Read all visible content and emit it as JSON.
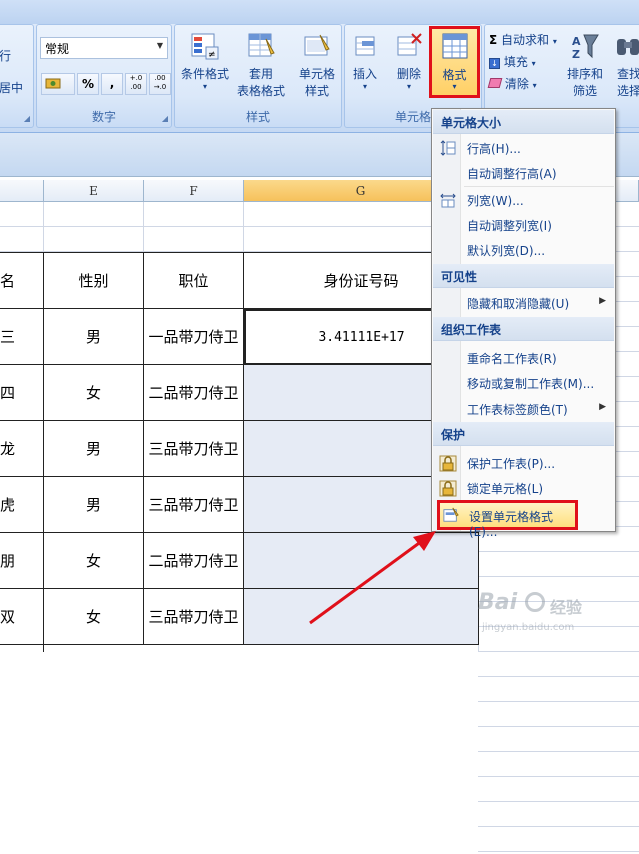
{
  "ribbon": {
    "align_group": {
      "label_frag1": "行",
      "label_frag2": "居中"
    },
    "number_group": {
      "label": "数字",
      "format_value": "常规",
      "percent": "%",
      "comma": ",",
      "inc_decimal": "+.0 .00",
      "dec_decimal": ".00 →.0"
    },
    "styles_group": {
      "label": "样式",
      "conditional_format": "条件格式",
      "table_format_l1": "套用",
      "table_format_l2": "表格格式",
      "cell_style_l1": "单元格",
      "cell_style_l2": "样式"
    },
    "cells_group": {
      "label": "单元格",
      "insert": "插入",
      "delete": "删除",
      "format": "格式"
    },
    "editing_group": {
      "autosum": "自动求和",
      "fill": "填充",
      "clear": "清除",
      "sort_l1": "排序和",
      "sort_l2": "筛选",
      "find_l1": "查找",
      "find_l2": "选择"
    }
  },
  "columns": [
    "E",
    "F",
    "G"
  ],
  "table": {
    "headers": [
      "名",
      "性别",
      "职位",
      "身份证号码"
    ],
    "rows": [
      [
        "三",
        "男",
        "一品带刀侍卫",
        "3.41111E+17"
      ],
      [
        "四",
        "女",
        "二品带刀侍卫",
        ""
      ],
      [
        "龙",
        "男",
        "三品带刀侍卫",
        ""
      ],
      [
        "虎",
        "男",
        "三品带刀侍卫",
        ""
      ],
      [
        "朋",
        "女",
        "二品带刀侍卫",
        ""
      ],
      [
        "双",
        "女",
        "三品带刀侍卫",
        ""
      ]
    ]
  },
  "menu": {
    "sections": [
      {
        "title": "单元格大小",
        "items": [
          "行高(H)...",
          "自动调整行高(A)",
          "列宽(W)...",
          "自动调整列宽(I)",
          "默认列宽(D)..."
        ]
      },
      {
        "title": "可见性",
        "items": [
          "隐藏和取消隐藏(U)"
        ]
      },
      {
        "title": "组织工作表",
        "items": [
          "重命名工作表(R)",
          "移动或复制工作表(M)...",
          "工作表标签颜色(T)"
        ]
      },
      {
        "title": "保护",
        "items": [
          "保护工作表(P)...",
          "锁定单元格(L)",
          "设置单元格格式(E)..."
        ]
      }
    ]
  },
  "watermark": {
    "brand": "Bai",
    "site": "jingyan.baidu.com",
    "suffix": "经验"
  },
  "colors": {
    "highlight_red": "#e0101a",
    "ribbon_text": "#15428b"
  }
}
